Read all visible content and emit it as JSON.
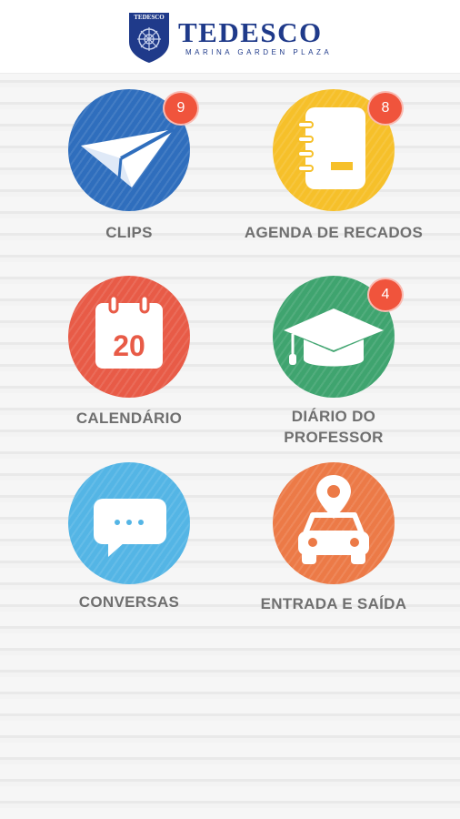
{
  "header": {
    "brand": "TEDESCO",
    "subtitle": "MARINA GARDEN PLAZA",
    "crest_text": "TEDESCO"
  },
  "colors": {
    "blue": "#2f6ebd",
    "yellow": "#f6c02a",
    "red": "#e85b47",
    "green": "#3fa46f",
    "light_blue": "#54b5e5",
    "orange": "#ec7a47",
    "badge": "#f0543c",
    "label": "#6f6f6f",
    "brand": "#1f3a8a"
  },
  "tiles": [
    {
      "label": "CLIPS",
      "icon": "paper-plane-icon",
      "badge": "9"
    },
    {
      "label": "AGENDA DE RECADOS",
      "icon": "notebook-icon",
      "badge": "8"
    },
    {
      "label": "CALENDÁRIO",
      "icon": "calendar-icon",
      "date": "20"
    },
    {
      "label": "DIÁRIO DO PROFESSOR",
      "icon": "graduation-cap-icon",
      "badge": "4"
    },
    {
      "label": "CONVERSAS",
      "icon": "chat-bubble-icon"
    },
    {
      "label": "ENTRADA E SAÍDA",
      "icon": "car-location-icon"
    }
  ]
}
